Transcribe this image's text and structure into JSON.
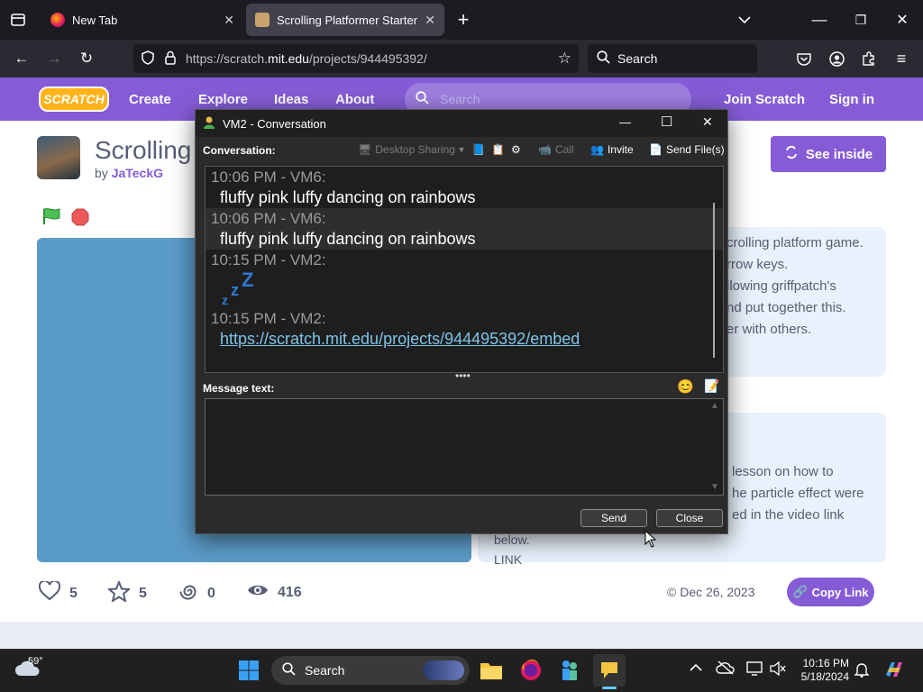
{
  "browser": {
    "tabs": [
      {
        "label": "New Tab",
        "active": false
      },
      {
        "label": "Scrolling Platformer Starter on",
        "active": true
      }
    ],
    "url_prefix": "https://scratch.",
    "url_host": "mit.edu",
    "url_path": "/projects/944495392/",
    "search_placeholder": "Search"
  },
  "scratch_nav": {
    "logo": "SCRATCH",
    "items": [
      "Create",
      "Explore",
      "Ideas",
      "About"
    ],
    "search_placeholder": "Search",
    "join": "Join Scratch",
    "signin": "Sign in"
  },
  "project": {
    "title": "Scrolling",
    "by": "by",
    "author": "JaTeckG",
    "see_inside": "See inside",
    "instructions_lines": [
      "crolling platform game.",
      "rrow keys.",
      "llowing griffpatch's",
      "nd put together this.",
      "er with others."
    ],
    "notes_lines": [
      "lesson on how to",
      "he particle effect were",
      "ed in the video link",
      "below.",
      "LINK"
    ],
    "stats": {
      "loves": "5",
      "favorites": "5",
      "remixes": "0",
      "views": "416"
    },
    "date": "Dec 26, 2023",
    "copy_link": "Copy Link"
  },
  "dialog": {
    "title": "VM2 - Conversation",
    "conversation_label": "Conversation:",
    "toolbar": {
      "desktop_sharing": "Desktop Sharing",
      "call": "Call",
      "invite": "Invite",
      "send_files": "Send File(s)"
    },
    "messages": [
      {
        "meta": "10:06 PM - VM6:",
        "text": "fluffy pink luffy dancing on rainbows"
      },
      {
        "meta": "10:06 PM - VM6:",
        "text": "fluffy pink luffy dancing on rainbows"
      },
      {
        "meta": "10:15 PM - VM2:",
        "text": ""
      },
      {
        "meta": "10:15 PM - VM2:",
        "link": "https://scratch.mit.edu/projects/944495392/embed"
      }
    ],
    "message_label": "Message text:",
    "message_value": "",
    "send": "Send",
    "close": "Close"
  },
  "taskbar": {
    "weather_temp": "59°",
    "search_label": "Search",
    "time": "10:16 PM",
    "date": "5/18/2024"
  },
  "colors": {
    "scratch_purple": "#855cd6",
    "link_blue": "#7fc4e8"
  }
}
